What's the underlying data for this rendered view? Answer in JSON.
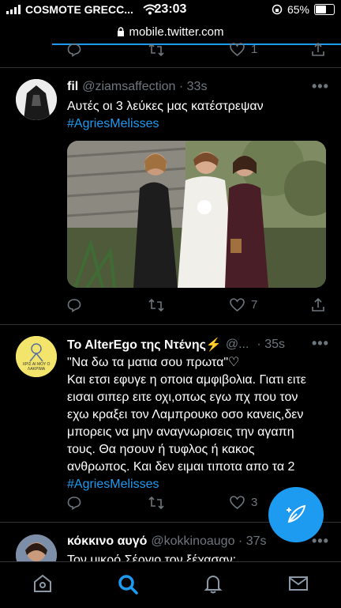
{
  "status_bar": {
    "carrier": "COSMOTE GRECC...",
    "time": "23:03",
    "battery": "65%",
    "battery_level": 0.65
  },
  "browser": {
    "url": "mobile.twitter.com"
  },
  "top_actions": {
    "like_count": "1"
  },
  "tweets": [
    {
      "name": "fil",
      "handle": "@ziamsaffection · 33s",
      "text": "Αυτές οι 3 λεύκες μας κατέστρεψαν",
      "hashtag": "#AgriesMelisses",
      "like_count": "7"
    },
    {
      "name": "To AlterEgo της Ντένης⚡",
      "handle": "@...",
      "time": "· 35s",
      "avatar_text": "ΧΡΙΣ ΑΙ ΜΟΥ Ο ΛΑΚΡΙΜΑ",
      "lines": [
        "\"Να δω τα ματια σου πρωτα\"♡",
        "Και ετσι εφυγε η οποια αμφιβολια. Γιατι ειτε",
        "εισαι σιπερ ειτε οχι,οπως εγω πχ που τον",
        "εχω κραξει τον Λαμπρουκο οσο κανεις,δεν",
        "μπορεις να μην αναγνωρισεις την αγαπη",
        "τους. Θα ησουν ή τυφλος ή κακος",
        "ανθρωπος. Και δεν ειμαι τιποτα απο τα 2"
      ],
      "hashtag": "#AgriesMelisses",
      "like_count": "3"
    },
    {
      "name": "κόκκινο αυγό",
      "handle": "@kokkinoaugo · 37s",
      "text": "Τον μικρό Σέργιο τον ξέχασαν;"
    }
  ],
  "icons": {
    "reply": "reply-icon",
    "retweet": "retweet-icon",
    "like": "heart-icon",
    "share": "share-icon",
    "compose": "compose-icon",
    "home": "home-icon",
    "search": "search-icon",
    "notifications": "bell-icon",
    "messages": "mail-icon"
  },
  "colors": {
    "accent": "#1d9bf0",
    "muted": "#6e767d",
    "background": "#000000"
  }
}
